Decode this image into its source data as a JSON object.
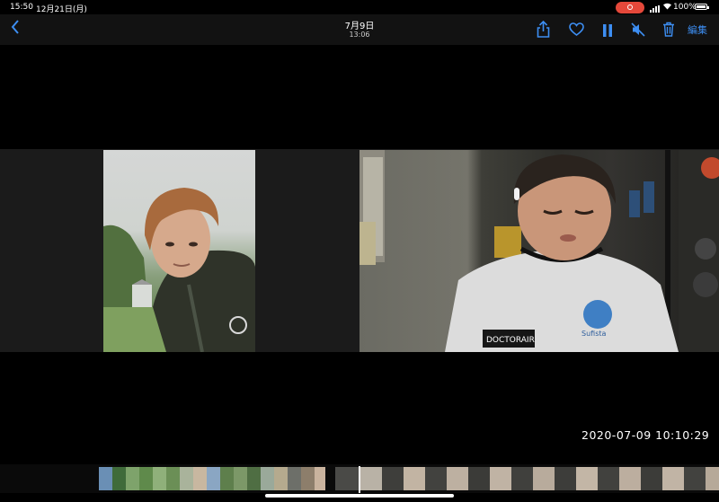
{
  "status_bar": {
    "time": "15:50",
    "date": "12月21日(月)",
    "battery": "100%"
  },
  "nav": {
    "back_icon": "chevron-left-icon",
    "title": "7月9日",
    "subtitle": "13:06",
    "tools": [
      "share-icon",
      "heart-icon",
      "pause-icon",
      "mute-icon",
      "trash-icon"
    ],
    "edit_label": "編集",
    "accent_color": "#3d8ef2"
  },
  "video": {
    "timestamp": "2020-07-09  10:10:29",
    "shirt_brand": "DOCTORAIR",
    "badge_text": "Sufista"
  },
  "filmstrip": {
    "playhead_position": 0.5
  },
  "colors": {
    "recording": "#e5483a",
    "background": "#000000"
  }
}
